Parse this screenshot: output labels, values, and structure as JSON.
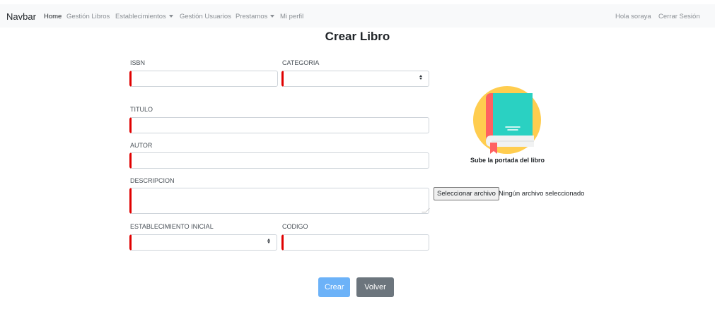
{
  "navbar": {
    "brand": "Navbar",
    "links": {
      "home": "Home",
      "gestion_libros": "Gestión Libros",
      "establecimientos": "Establecimientos",
      "gestion_usuarios": "Gestión Usuarios",
      "prestamos": "Prestamos",
      "mi_perfil": "Mi perfil"
    },
    "greeting": "Hola soraya",
    "logout": "Cerrar Sesión"
  },
  "page_title": "Crear Libro",
  "form": {
    "isbn": {
      "label": "ISBN",
      "value": ""
    },
    "categoria": {
      "label": "CATEGORIA",
      "selected": ""
    },
    "titulo": {
      "label": "TITULO",
      "value": ""
    },
    "autor": {
      "label": "AUTOR",
      "value": ""
    },
    "descripcion": {
      "label": "DESCRIPCION",
      "value": ""
    },
    "establecimiento": {
      "label": "ESTABLECIMIENTO INICIAL",
      "selected": ""
    },
    "codigo": {
      "label": "CODIGO",
      "value": ""
    }
  },
  "cover": {
    "caption": "Sube la portada del libro",
    "file_button": "Seleccionar archivo",
    "file_status": "Ningún archivo seleccionado",
    "icon": "book-cover-icon"
  },
  "buttons": {
    "create": "Crear",
    "back": "Volver"
  },
  "colors": {
    "required_marker": "#e00000",
    "primary": "#6cb2f8",
    "secondary": "#6c757d",
    "icon_circle": "#ffcd4f",
    "book_cover": "#2ad1c2",
    "book_spine": "#ff6161"
  }
}
